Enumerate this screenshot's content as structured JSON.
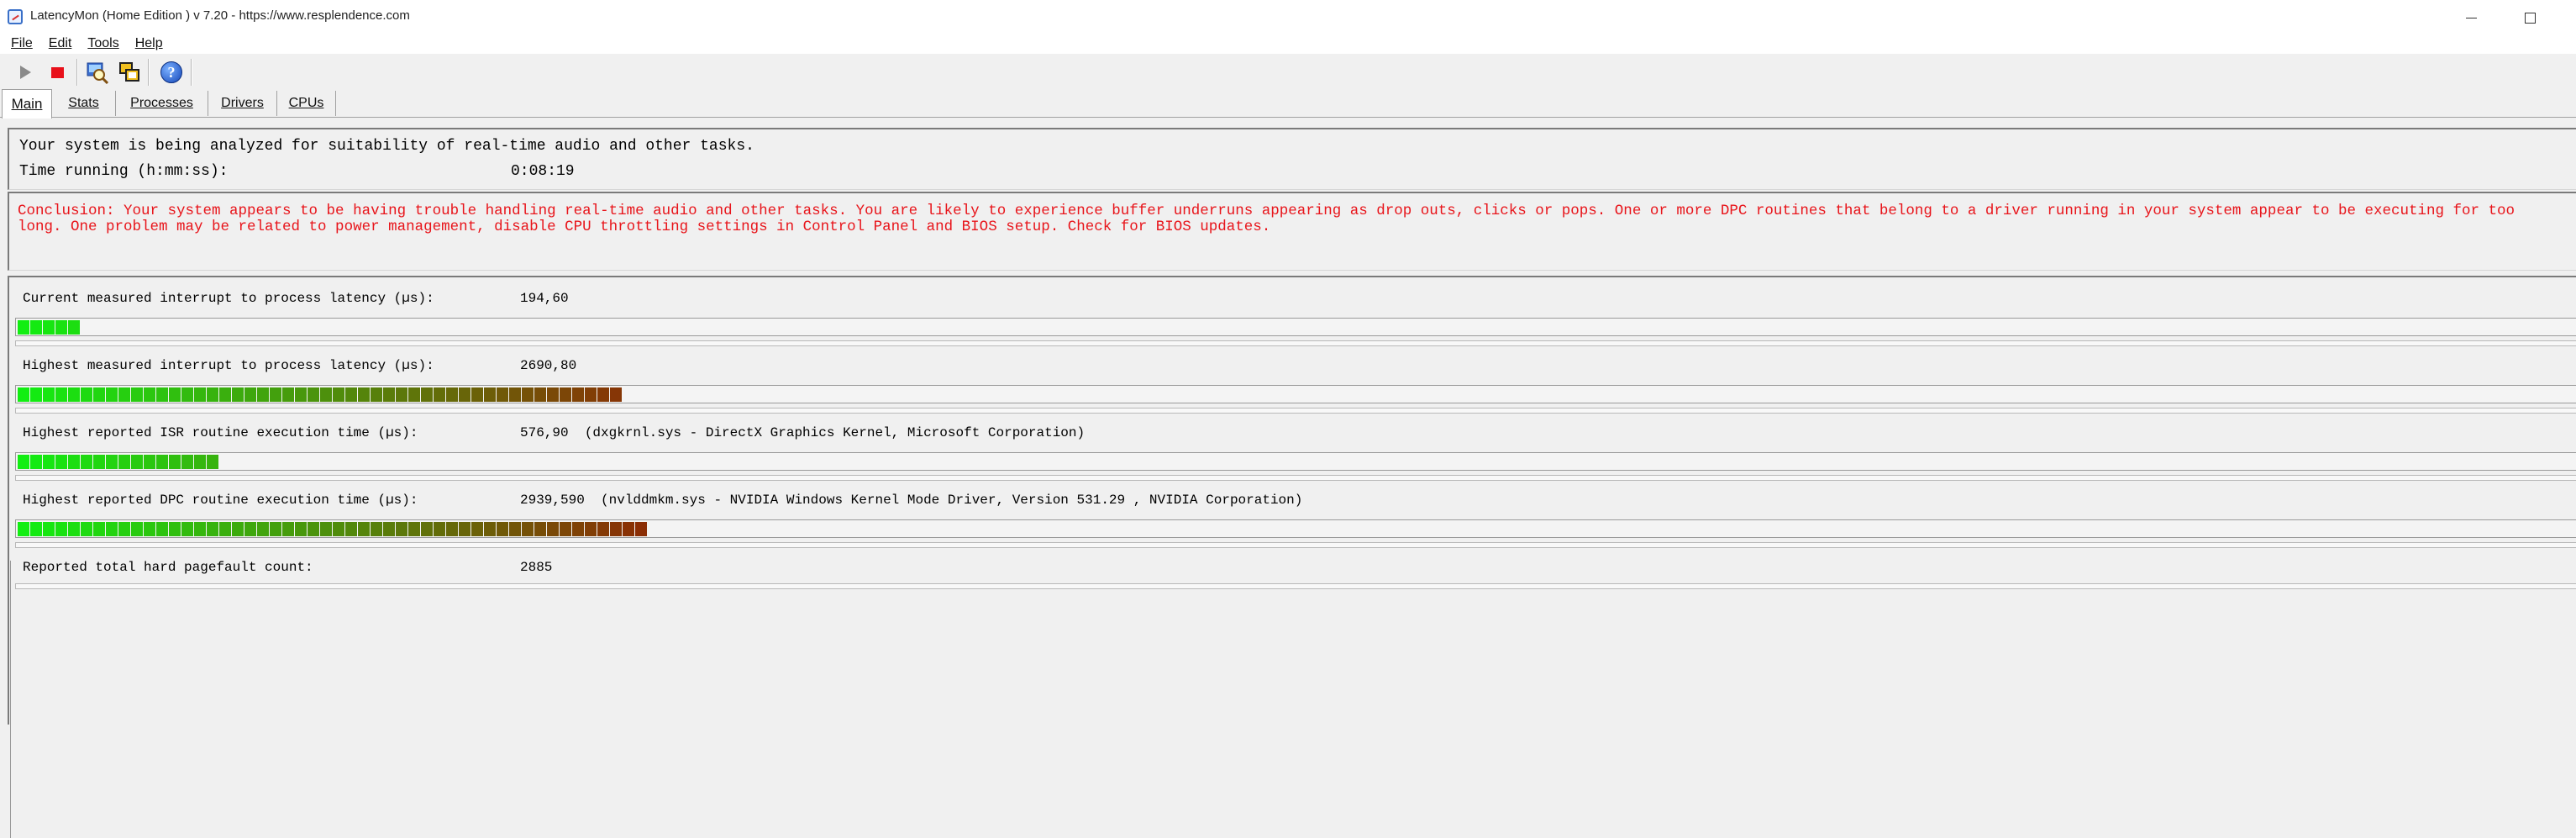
{
  "window": {
    "title": "LatencyMon  (Home Edition )  v 7.20 - https://www.resplendence.com"
  },
  "menu": [
    "File",
    "Edit",
    "Tools",
    "Help"
  ],
  "toolbar": {
    "buttons": [
      "play-icon",
      "stop-icon",
      "magnify-icon",
      "windows-icon",
      "help-icon"
    ],
    "help_glyph": "?"
  },
  "tabs": [
    {
      "label": "Main",
      "active": true
    },
    {
      "label": "Stats"
    },
    {
      "label": "Processes"
    },
    {
      "label": "Drivers"
    },
    {
      "label": "CPUs"
    }
  ],
  "main": {
    "status_line": "Your system is being analyzed for suitability of real-time audio and other tasks.",
    "time_running_label": "Time running (h:mm:ss):",
    "time_running_value": "0:08:19",
    "conclusion": "Conclusion: Your system appears to be having trouble handling real-time audio and other tasks. You are likely to experience buffer underruns appearing as drop outs, clicks or pops. One or more DPC routines that belong to a driver running in your system appear to be executing for too long. One problem may be related to power management, disable CPU throttling settings in Control Panel and BIOS setup. Check for BIOS updates.",
    "metrics": [
      {
        "label": "Current measured interrupt to process latency (µs):",
        "value": "194,60",
        "detail": "",
        "level_segments": 5
      },
      {
        "label": "Highest measured interrupt to process latency (µs):",
        "value": "2690,80",
        "detail": "",
        "level_segments": 48
      },
      {
        "label": "Highest reported ISR routine execution time (µs):",
        "value": "576,90",
        "detail": "(dxgkrnl.sys - DirectX Graphics Kernel, Microsoft Corporation)",
        "level_segments": 16
      },
      {
        "label": "Highest reported DPC routine execution time (µs):",
        "value": "2939,590",
        "detail": "(nvlddmkm.sys - NVIDIA Windows Kernel Mode Driver, Version 531.29 , NVIDIA Corporation)",
        "level_segments": 50
      },
      {
        "label": "Reported total hard pagefault count:",
        "value": "2885",
        "detail": ""
      }
    ]
  },
  "colors": {
    "conclusion_text": "#e8141a",
    "meter_start": "#12ee12",
    "meter_end": "#8b2e05"
  }
}
